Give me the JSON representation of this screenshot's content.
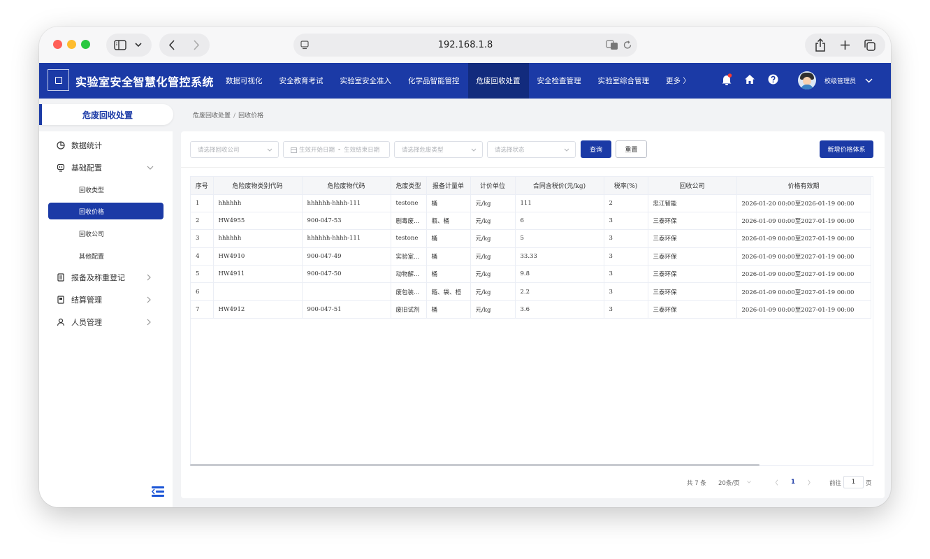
{
  "browser": {
    "url": "192.168.1.8"
  },
  "app": {
    "title": "实验室安全智慧化管控系统"
  },
  "topnav": [
    {
      "label": "数据可视化"
    },
    {
      "label": "安全教育考试"
    },
    {
      "label": "实验室安全准入"
    },
    {
      "label": "化学品智能管控"
    },
    {
      "label": "危废回收处置"
    },
    {
      "label": "安全检查管理"
    },
    {
      "label": "实验室综合管理"
    },
    {
      "label": "更多 〉"
    }
  ],
  "user": {
    "name": "校级管理员"
  },
  "sidebar": {
    "header": "危废回收处置",
    "items": [
      {
        "label": "数据统计",
        "icon": "pie-chart-icon"
      },
      {
        "label": "基础配置",
        "icon": "config-icon"
      },
      {
        "label": "报备及称重登记",
        "icon": "doc-icon"
      },
      {
        "label": "结算管理",
        "icon": "settle-icon"
      },
      {
        "label": "人员管理",
        "icon": "user-icon"
      }
    ],
    "subitems": [
      {
        "label": "回收类型"
      },
      {
        "label": "回收价格"
      },
      {
        "label": "回收公司"
      },
      {
        "label": "其他配置"
      }
    ]
  },
  "breadcrumb": {
    "parent": "危废回收处置",
    "current": "回收价格"
  },
  "filters": {
    "company_placeholder": "请选择回收公司",
    "start_placeholder": "生效开始日期",
    "range_sep": "-",
    "end_placeholder": "生效结束日期",
    "type_placeholder": "请选择危废类型",
    "status_placeholder": "请选择状态",
    "query_label": "查询",
    "reset_label": "重置",
    "add_label": "新增价格体系"
  },
  "table": {
    "headers": [
      "序号",
      "危险废物类别代码",
      "危险废物代码",
      "危废类型",
      "报备计量单",
      "计价单位",
      "合同含税价(元/kg)",
      "税率(%)",
      "回收公司",
      "价格有效期"
    ],
    "rows": [
      [
        "1",
        "hhhhhh",
        "hhhhhh-hhhh-111",
        "testone",
        "桶",
        "元/kg",
        "111",
        "2",
        "忠江智能",
        "2026-01-20 00:00至2026-01-19 00:00"
      ],
      [
        "2",
        "HW4955",
        "900-047-53",
        "剧毒废...",
        "瓶、桶",
        "元/kg",
        "6",
        "3",
        "三泰环保",
        "2026-01-09 00:00至2027-01-19 00:00"
      ],
      [
        "3",
        "hhhhhh",
        "hhhhhh-hhhh-111",
        "testone",
        "桶",
        "元/kg",
        "5",
        "3",
        "三泰环保",
        "2026-01-09 00:00至2027-01-19 00:00"
      ],
      [
        "4",
        "HW4910",
        "900-047-49",
        "实验室...",
        "桶",
        "元/kg",
        "33.33",
        "3",
        "三泰环保",
        "2026-01-09 00:00至2027-01-19 00:00"
      ],
      [
        "5",
        "HW4911",
        "900-047-50",
        "动物解...",
        "桶",
        "元/kg",
        "9.8",
        "3",
        "三泰环保",
        "2026-01-09 00:00至2027-01-19 00:00"
      ],
      [
        "6",
        "",
        "",
        "废包装...",
        "箱、袋、桓",
        "元/kg",
        "2.2",
        "3",
        "三泰环保",
        "2026-01-09 00:00至2027-01-19 00:00"
      ],
      [
        "7",
        "HW4912",
        "900-047-51",
        "废旧试剂",
        "桶",
        "元/kg",
        "3.6",
        "3",
        "三泰环保",
        "2026-01-09 00:00至2027-01-19 00:00"
      ]
    ]
  },
  "pagination": {
    "total": "共 7 条",
    "page_size": "20条/页",
    "prev": "〈",
    "current_page": "1",
    "next": "〉",
    "goto_label": "前往",
    "goto_value": "1",
    "page_suffix": "页"
  },
  "colors": {
    "brand": "#1b3aa6",
    "brand_dark": "#122b7d"
  }
}
